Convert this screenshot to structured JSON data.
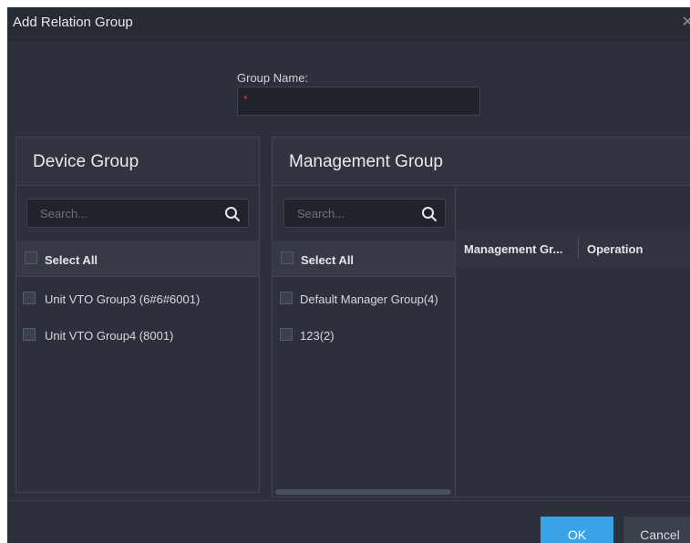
{
  "dialog": {
    "title": "Add Relation Group",
    "close_icon": "close-icon"
  },
  "group_name": {
    "label": "Group Name:",
    "value": "",
    "required_mark": "*"
  },
  "device_group": {
    "title": "Device Group",
    "search_placeholder": "Search...",
    "select_all_label": "Select All",
    "items": [
      {
        "label": "Unit VTO Group3 (6#6#6001)"
      },
      {
        "label": "Unit VTO Group4 (8001)"
      }
    ]
  },
  "management_group": {
    "title": "Management Group",
    "search_placeholder": "Search...",
    "select_all_label": "Select All",
    "items": [
      {
        "label": "Default Manager Group(4)"
      },
      {
        "label": "123(2)"
      }
    ],
    "table": {
      "columns": [
        "Management Gr...",
        "Operation"
      ]
    }
  },
  "footer": {
    "ok_label": "OK",
    "cancel_label": "Cancel"
  },
  "colors": {
    "background": "#2b303a",
    "accent": "#3aa3e8",
    "required": "#e0383e"
  }
}
